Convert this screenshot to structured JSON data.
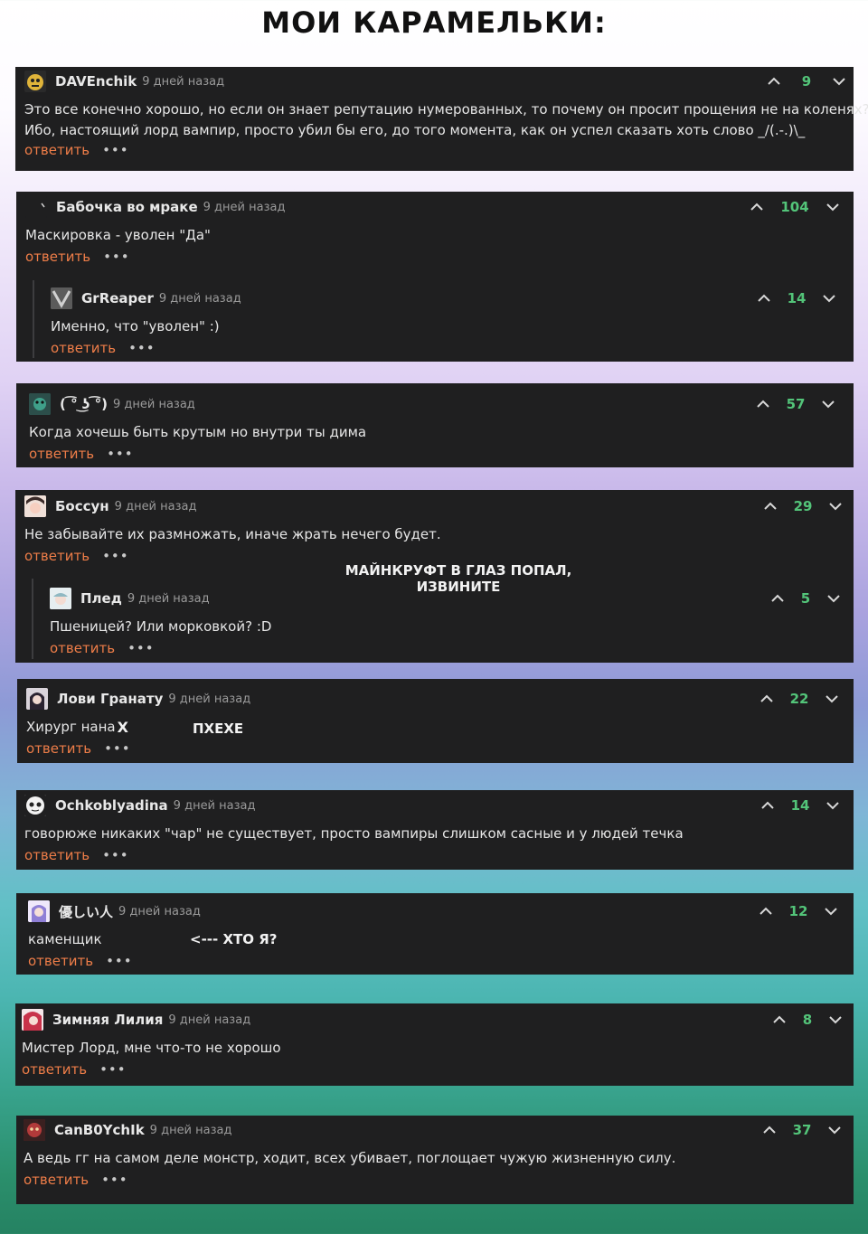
{
  "header": {
    "title": "мои карамельки:"
  },
  "common": {
    "reply_label": "ответить",
    "more_label": "•••"
  },
  "comments": [
    {
      "author": "DAVEnchik",
      "time": "9 дней назад",
      "score": "9",
      "text_lines": [
        "Это все конечно хорошо, но если он знает репутацию нумерованных, то почему он просит прощения не на коленях?",
        "Ибо, настоящий лорд вампир, просто убил бы его, до того момента, как он успел сказать хоть слово _/(.-.)\\_"
      ],
      "avatar_color": "#e0b43a"
    },
    {
      "author": "Бабочка во мраке",
      "time": "9 дней назад",
      "score": "104",
      "text_lines": [
        "Маскировка - уволен \"Да\""
      ],
      "avatar_color": "#1f1f20",
      "replies": [
        {
          "author": "GrReaper",
          "time": "9 дней назад",
          "score": "14",
          "text_lines": [
            "Именно, что \"уволен\" :)"
          ],
          "avatar_color": "#8a8a8a"
        }
      ]
    },
    {
      "author": "( ͡° ͜ʖ ͡°)",
      "time": "9 дней назад",
      "score": "57",
      "text_lines": [
        "Когда хочешь быть крутым но внутри ты дима"
      ],
      "avatar_color": "#3c6a5a"
    },
    {
      "author": "Боссун",
      "time": "9 дней назад",
      "score": "29",
      "text_lines": [
        "Не забывайте их размножать, иначе жрать нечего будет."
      ],
      "avatar_color": "#d8a8a0",
      "replies": [
        {
          "author": "Плед",
          "time": "9 дней назад",
          "score": "5",
          "text_lines": [
            "Пшеницей? Или морковкой? :D"
          ],
          "avatar_color": "#cfd8dc"
        }
      ]
    },
    {
      "author": "Лови Гранату",
      "time": "9 дней назад",
      "score": "22",
      "text_lines": [
        "Хирург нана"
      ],
      "avatar_color": "#6a5a6e"
    },
    {
      "author": "Ochkoblyadina",
      "time": "9 дней назад",
      "score": "14",
      "text_lines": [
        "говорюже никаких \"чар\" не существует, просто вампиры слишком сасные и у людей течка"
      ],
      "avatar_color": "#e8e8e8"
    },
    {
      "author": "優しい人",
      "time": "9 дней назад",
      "score": "12",
      "text_lines": [
        "каменщик"
      ],
      "avatar_color": "#b9a7e6"
    },
    {
      "author": "Зимняя Лилия",
      "time": "9 дней назад",
      "score": "8",
      "text_lines": [
        "Мистер Лорд, мне что-то не хорошо"
      ],
      "avatar_color": "#c8324a"
    },
    {
      "author": "CanB0YchIk",
      "time": "9 дней назад",
      "score": "37",
      "text_lines": [
        "А ведь гг на самом деле монстр, ходит, всех убивает, поглощает чужую жизненную силу."
      ],
      "avatar_color": "#8a2a2a"
    }
  ],
  "annotations": {
    "minecraft_note": [
      "майнкруфт в глаз попал,",
      "извините"
    ],
    "x_mark": "Х",
    "hehe": "пхехе",
    "who_am_i": "<--- хто я?"
  }
}
